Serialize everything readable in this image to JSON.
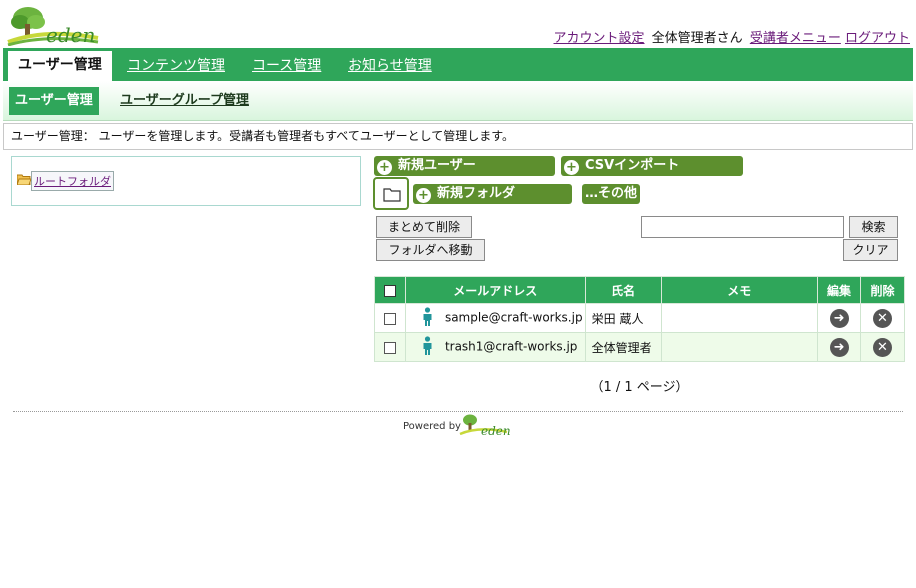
{
  "header": {
    "logo_text": "eden",
    "links": {
      "account_settings": "アカウント設定",
      "greeting": "全体管理者さん",
      "learner_menu": "受講者メニュー",
      "logout": "ログアウト"
    }
  },
  "main_nav": {
    "tabs": [
      {
        "label": "ユーザー管理",
        "active": true
      },
      {
        "label": "コンテンツ管理",
        "active": false
      },
      {
        "label": "コース管理",
        "active": false
      },
      {
        "label": "お知らせ管理",
        "active": false
      }
    ]
  },
  "sub_nav": {
    "tabs": [
      {
        "label": "ユーザー管理",
        "active": true
      },
      {
        "label": "ユーザーグループ管理",
        "active": false
      }
    ]
  },
  "description": "ユーザー管理： ユーザーを管理します。受講者も管理者もすべてユーザーとして管理します。",
  "tree": {
    "root_label": "ルートフォルダ"
  },
  "actions": {
    "new_user": "新規ユーザー",
    "csv_import": "CSVインポート",
    "new_folder": "新規フォルダ",
    "other": "…その他",
    "bulk_delete": "まとめて削除",
    "move_to_folder": "フォルダへ移動",
    "search": "検索",
    "clear": "クリア",
    "search_value": ""
  },
  "table": {
    "headers": {
      "email": "メールアドレス",
      "name": "氏名",
      "memo": "メモ",
      "edit": "編集",
      "delete": "削除"
    },
    "rows": [
      {
        "email": "sample@craft-works.jp",
        "name": "栄田 蔵人",
        "memo": ""
      },
      {
        "email": "trash1@craft-works.jp",
        "name": "全体管理者",
        "memo": ""
      }
    ]
  },
  "pager": "（1 / 1 ページ）",
  "footer": {
    "powered_by": "Powered by",
    "logo_text": "eden"
  },
  "colors": {
    "primary_green": "#2fa65a",
    "action_green": "#5d8f2e",
    "link_purple": "#6a1b7a"
  }
}
